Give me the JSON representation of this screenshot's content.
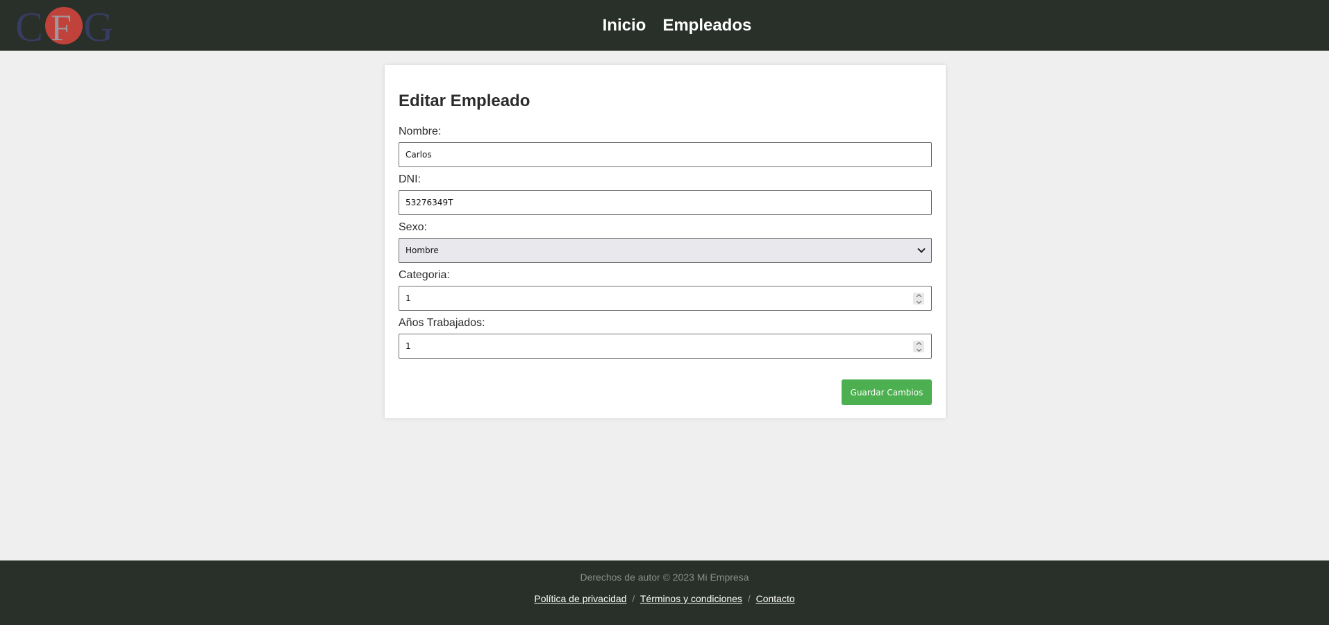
{
  "header": {
    "logo_text": "CFG",
    "nav": [
      "Inicio",
      "Empleados"
    ]
  },
  "form": {
    "title": "Editar Empleado",
    "fields": {
      "nombre": {
        "label": "Nombre:",
        "value": "Carlos"
      },
      "dni": {
        "label": "DNI:",
        "value": "53276349T"
      },
      "sexo": {
        "label": "Sexo:",
        "value": "Hombre"
      },
      "categoria": {
        "label": "Categoria:",
        "value": "1"
      },
      "anios": {
        "label": "Años Trabajados:",
        "value": "1"
      }
    },
    "save_label": "Guardar Cambios"
  },
  "footer": {
    "copyright": "Derechos de autor © 2023 Mi Empresa",
    "links": [
      "Política de privacidad",
      "Términos y condiciones",
      "Contacto"
    ],
    "separator": "/"
  },
  "colors": {
    "header_bg": "#283029",
    "page_bg": "#efefef",
    "save_button": "#4caf50"
  }
}
